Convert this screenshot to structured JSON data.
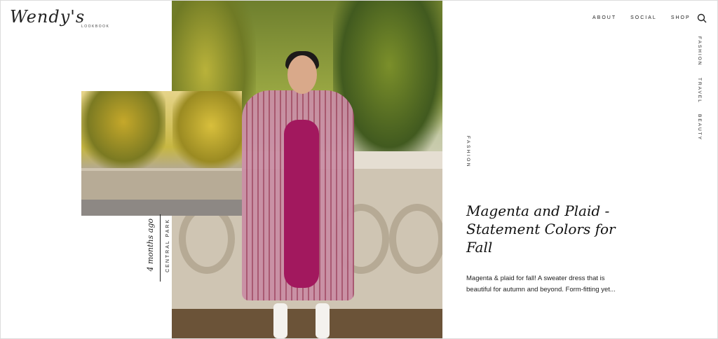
{
  "logo": {
    "script": "Wendy's",
    "sub": "LOOKBOOK"
  },
  "nav": {
    "top": [
      "ABOUT",
      "SOCIAL",
      "SHOP"
    ],
    "vertical": [
      "FASHION",
      "TRAVEL",
      "BEAUTY"
    ]
  },
  "icons": {
    "search": "search-icon"
  },
  "post": {
    "category": "FASHION",
    "date": "4 months ago",
    "location": "CENTRAL PARK",
    "title": "Magenta and Plaid - Statement Colors for Fall",
    "excerpt": "Magenta & plaid for fall! A sweater dress that is beautiful for autumn and beyond. Form-fitting yet..."
  },
  "colors": {
    "text": "#1a1a1a",
    "background": "#ffffff",
    "coat": "#c98fa5",
    "dress": "#a2185e"
  }
}
